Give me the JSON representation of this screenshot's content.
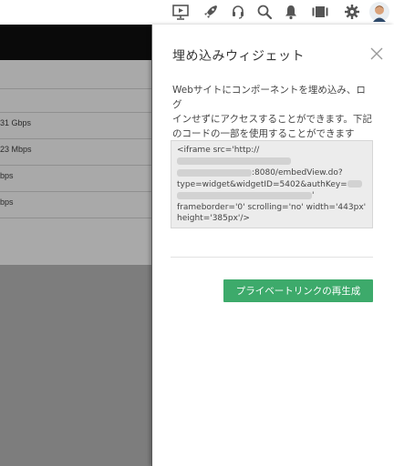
{
  "toolbar": {
    "icons": [
      "presentation-icon",
      "rocket-icon",
      "headset-icon",
      "search-icon",
      "bell-icon",
      "panels-icon",
      "gear-icon",
      "avatar"
    ]
  },
  "background": {
    "rows": [
      "31 Gbps",
      "23 Mbps",
      "bps",
      "bps"
    ]
  },
  "panel": {
    "title": "埋め込みウィジェット",
    "description_lines": [
      "Webサイトにコンポーネントを埋め込み、ログ",
      "インせずにアクセスすることができます。下記",
      "のコードの一部を使用することができます"
    ],
    "code": {
      "line1": "<iframe src='http://",
      "line2": ":8080/embedView.do?",
      "line3": "type=widget&widgetID=5402&authKey=",
      "line4": "'",
      "line5": "frameborder='0' scrolling='no' width='443px'",
      "line6": "height='385px'/>"
    },
    "regenerate_button": "プライベートリンクの再生成"
  },
  "colors": {
    "accent_green": "#3daa6b",
    "overlay_gray": "#7d7d7d"
  }
}
